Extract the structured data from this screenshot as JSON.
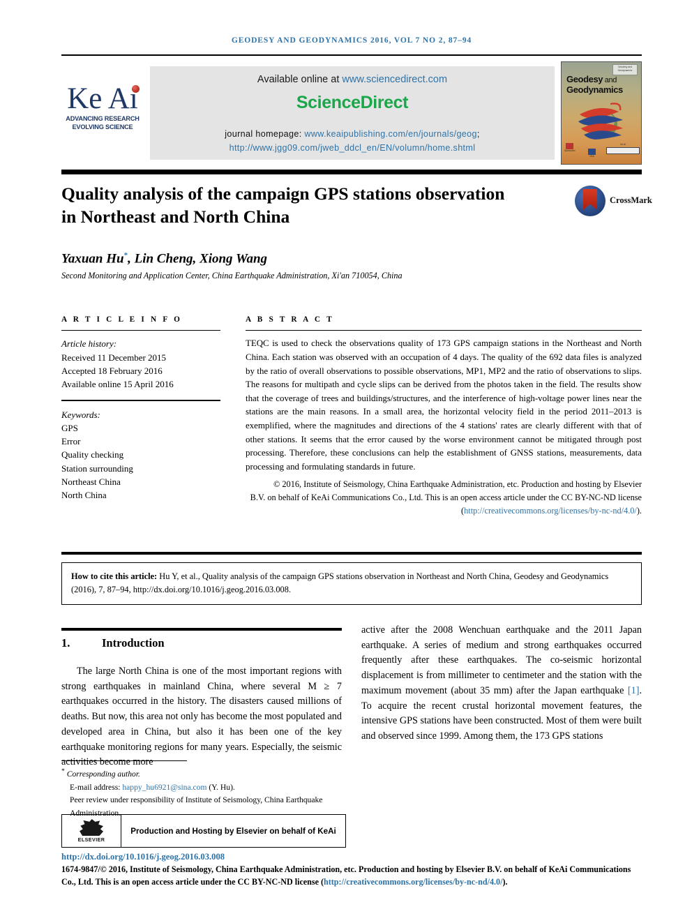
{
  "running_head": "GEODESY AND GEODYNAMICS 2016, VOL 7 NO 2, 87–94",
  "masthead": {
    "keai_word": "Ke Ai",
    "keai_tagline_1": "ADVANCING RESEARCH",
    "keai_tagline_2": "EVOLVING SCIENCE",
    "available_online_prefix": "Available online at ",
    "sciencedirect_url": "www.sciencedirect.com",
    "sciencedirect_brand": "ScienceDirect",
    "homepage_label": "journal homepage: ",
    "homepage_url_1": "www.keaipublishing.com/en/journals/geog",
    "homepage_url_2": "http://www.jgg09.com/jweb_ddcl_en/EN/volumn/home.shtml",
    "cover": {
      "badge_line_1": "Geodesy and",
      "badge_line_2": "Geodynamics",
      "title_line_1": "Geodesy",
      "title_and": " and",
      "title_line_2": "Geodynamics",
      "foot_1": "Sponsored",
      "foot_2": "CEA",
      "foot_3": "Ke Ai"
    }
  },
  "article": {
    "title": "Quality analysis of the campaign GPS stations observation in Northeast and North China",
    "crossmark_label": "CrossMark",
    "authors_pre": "Yaxuan Hu",
    "authors_star": "*",
    "authors_post": ", Lin Cheng, Xiong Wang",
    "affiliation": "Second Monitoring and Application Center, China Earthquake Administration, Xi'an 710054, China"
  },
  "article_info": {
    "heading": "A R T I C L E   I N F O",
    "history_label": "Article history:",
    "history": [
      "Received 11 December 2015",
      "Accepted 18 February 2016",
      "Available online 15 April 2016"
    ],
    "keywords_label": "Keywords:",
    "keywords": [
      "GPS",
      "Error",
      "Quality checking",
      "Station surrounding",
      "Northeast China",
      "North China"
    ]
  },
  "abstract": {
    "heading": "A B S T R A C T",
    "body": "TEQC is used to check the observations quality of 173 GPS campaign stations in the Northeast and North China. Each station was observed with an occupation of 4 days. The quality of the 692 data files is analyzed by the ratio of overall observations to possible observations, MP1, MP2 and the ratio of observations to slips. The reasons for multipath and cycle slips can be derived from the photos taken in the field. The results show that the coverage of trees and buildings/structures, and the interference of high-voltage power lines near the stations are the main reasons. In a small area, the horizontal velocity field in the period 2011–2013 is exemplified, where the magnitudes and directions of the 4 stations' rates are clearly different with that of other stations. It seems that the error caused by the worse environment cannot be mitigated through post processing. Therefore, these conclusions can help the establishment of GNSS stations, measurements, data processing and formulating standards in future.",
    "copyright_text": "© 2016, Institute of Seismology, China Earthquake Administration, etc. Production and hosting by Elsevier B.V. on behalf of KeAi Communications Co., Ltd. This is an open access article under the CC BY-NC-ND license (",
    "copyright_link": "http://creativecommons.org/licenses/by-nc-nd/4.0/",
    "copyright_tail": ")."
  },
  "cite_box": {
    "label": "How to cite this article:",
    "text": " Hu Y, et al., Quality analysis of the campaign GPS stations observation in Northeast and North China, Geodesy and Geodynamics (2016), 7, 87–94, http://dx.doi.org/10.1016/j.geog.2016.03.008."
  },
  "introduction": {
    "number": "1.",
    "title": "Introduction",
    "left_paragraph": "The large North China is one of the most important regions with strong earthquakes in mainland China, where several M ≥ 7 earthquakes occurred in the history. The disasters caused millions of deaths. But now, this area not only has become the most populated and developed area in China, but also it has been one of the key earthquake monitoring regions for many years. Especially, the seismic activities become more",
    "right_paragraph_part1": "active after the 2008 Wenchuan earthquake and the 2011 Japan earthquake. A series of medium and strong earthquakes occurred frequently after these earthquakes. The co-seismic horizontal displacement is from millimeter to centimeter and the station with the maximum movement (about 35 mm) after the Japan earthquake ",
    "right_reference": "[1]",
    "right_paragraph_part2": ". To acquire the recent crustal horizontal movement features, the intensive GPS stations have been constructed. Most of them were built and observed since 1999. Among them, the 173 GPS stations"
  },
  "footnote": {
    "star": "*",
    "corresponding": "Corresponding author.",
    "email_label": "E-mail address: ",
    "email": "happy_hu6921@sina.com",
    "email_tail": " (Y. Hu).",
    "peer_review": "Peer review under responsibility of Institute of Seismology, China Earthquake Administration."
  },
  "elsevier_box": {
    "logo_word": "ELSEVIER",
    "text": "Production and Hosting by Elsevier on behalf of KeAi"
  },
  "footer": {
    "doi": "http://dx.doi.org/10.1016/j.geog.2016.03.008",
    "legal_text": "1674-9847/© 2016, Institute of Seismology, China Earthquake Administration, etc. Production and hosting by Elsevier B.V. on behalf of KeAi Communications Co., Ltd. This is an open access article under the CC BY-NC-ND license (",
    "legal_link": "http://creativecommons.org/licenses/by-nc-nd/4.0/",
    "legal_tail": ")."
  },
  "colors": {
    "link": "#2E73A8",
    "sciencedirect_green": "#19A74A",
    "keai_navy": "#1F3864",
    "keai_dot_red": "#C0392B"
  }
}
